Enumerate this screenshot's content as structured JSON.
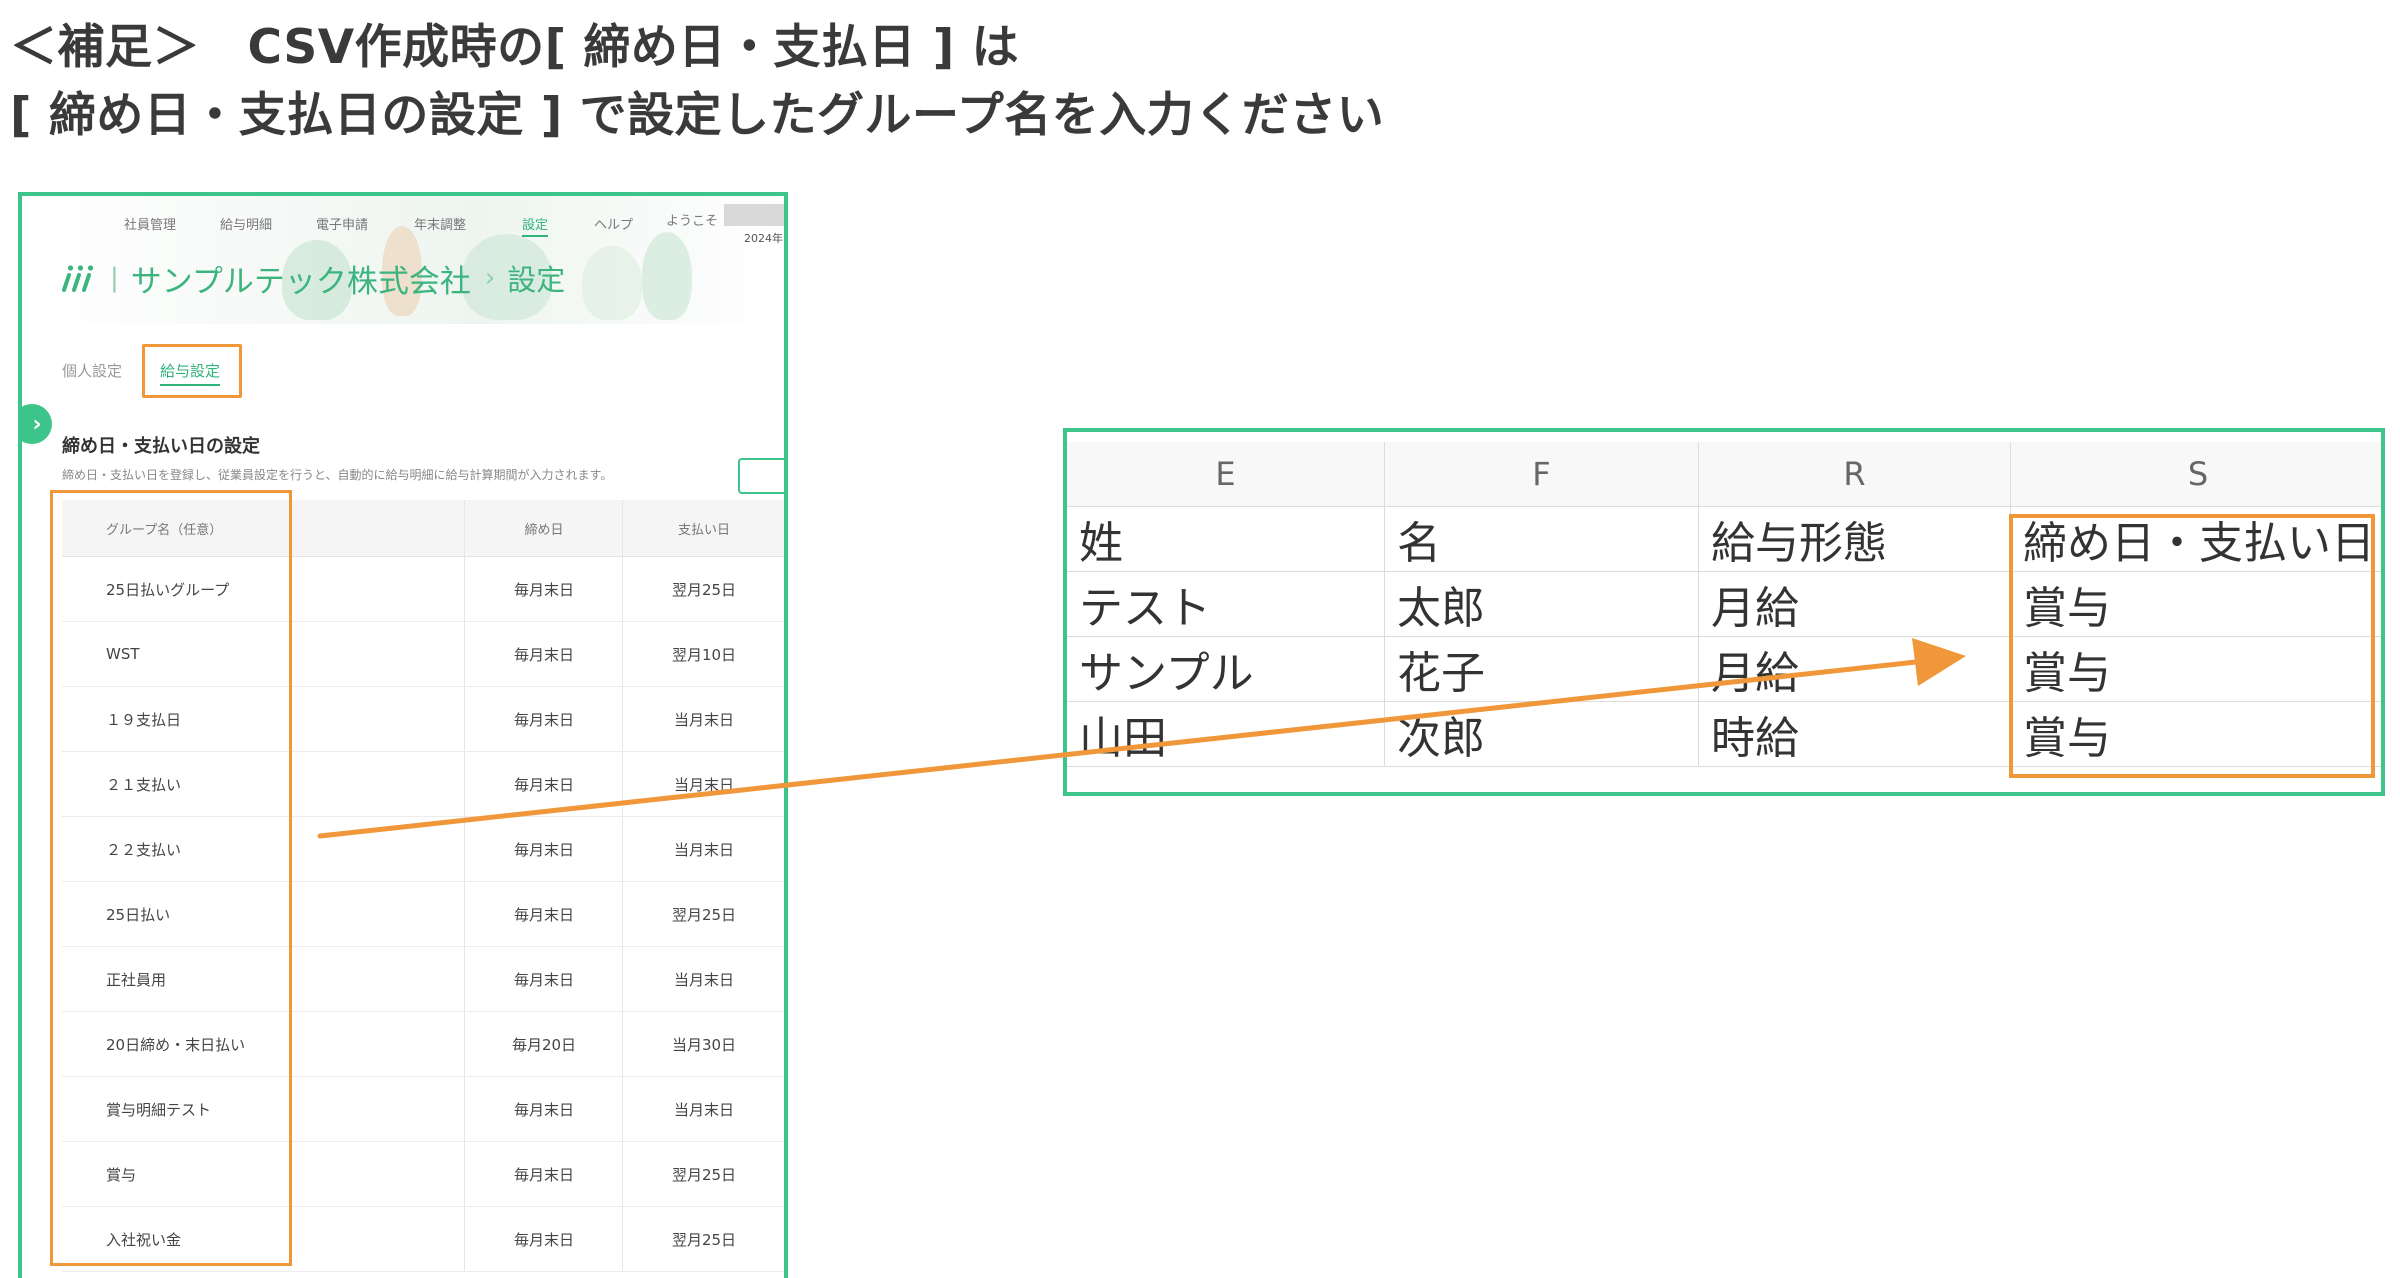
{
  "note": {
    "line1": "＜補足＞　CSV作成時の[ 締め日・支払日 ] は",
    "line2": "[ 締め日・支払日の設定 ] で設定したグループ名を入力ください"
  },
  "app": {
    "topnav": [
      "社員管理",
      "給与明細",
      "電子申請",
      "年末調整",
      "設定",
      "ヘルプ"
    ],
    "topnav_active": "設定",
    "welcome": "ようこそ",
    "date": "2024年",
    "company": "サンプルテック株式会社",
    "breadcrumb_current": "設定",
    "tabs": {
      "personal": "個人設定",
      "payroll": "給与設定"
    },
    "section_title": "締め日・支払い日の設定",
    "section_desc": "締め日・支払い日を登録し、従業員設定を行うと、自動的に給与明細に給与計算期間が入力されます。",
    "table": {
      "headers": {
        "name": "グループ名（任意）",
        "close": "締め日",
        "pay": "支払い日"
      },
      "rows": [
        {
          "name": "25日払いグループ",
          "close": "毎月末日",
          "pay": "翌月25日"
        },
        {
          "name": "WST",
          "close": "毎月末日",
          "pay": "翌月10日"
        },
        {
          "name": "１９支払日",
          "close": "毎月末日",
          "pay": "当月末日"
        },
        {
          "name": "２１支払い",
          "close": "毎月末日",
          "pay": "当月末日"
        },
        {
          "name": "２２支払い",
          "close": "毎月末日",
          "pay": "当月末日"
        },
        {
          "name": "25日払い",
          "close": "毎月末日",
          "pay": "翌月25日"
        },
        {
          "name": "正社員用",
          "close": "毎月末日",
          "pay": "当月末日"
        },
        {
          "name": "20日締め・末日払い",
          "close": "毎月20日",
          "pay": "当月30日"
        },
        {
          "name": "賞与明細テスト",
          "close": "毎月末日",
          "pay": "当月末日"
        },
        {
          "name": "賞与",
          "close": "毎月末日",
          "pay": "翌月25日"
        },
        {
          "name": "入社祝い金",
          "close": "毎月末日",
          "pay": "翌月25日"
        }
      ]
    }
  },
  "csv": {
    "columns": [
      "E",
      "F",
      "R",
      "S"
    ],
    "rows": [
      [
        "姓",
        "名",
        "給与形態",
        "締め日・支払い日"
      ],
      [
        "テスト",
        "太郎",
        "月給",
        "賞与"
      ],
      [
        "サンプル",
        "花子",
        "月給",
        "賞与"
      ],
      [
        "山田",
        "次郎",
        "時給",
        "賞与"
      ]
    ]
  },
  "colors": {
    "panel_border": "#3cc48a",
    "highlight": "#f0973a",
    "brand_green": "#3cb47e"
  },
  "icons": {
    "logo": "logo-icon",
    "expand": "chevron-right-icon",
    "arrow": "arrow-right-icon"
  }
}
